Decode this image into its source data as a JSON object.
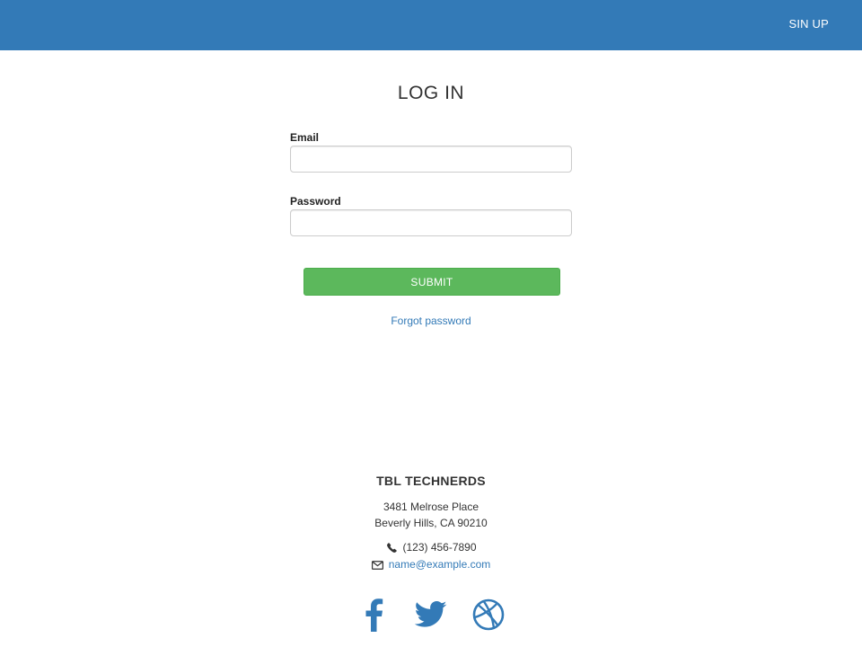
{
  "navbar": {
    "signup_label": "SIN UP",
    "background_color": "#337ab7"
  },
  "login": {
    "title": "LOG IN",
    "email_label": "Email",
    "email_value": "",
    "email_placeholder": "",
    "password_label": "Password",
    "password_value": "",
    "password_placeholder": "",
    "submit_label": "SUBMIT",
    "submit_color": "#5cb85c",
    "forgot_label": "Forgot password"
  },
  "footer": {
    "company": "TBL TECHNERDS",
    "address_line1": "3481 Melrose Place",
    "address_line2": "Beverly Hills, CA 90210",
    "phone": "(123) 456-7890",
    "email": "name@example.com",
    "phone_icon": "phone-icon",
    "email_icon": "envelope-icon",
    "social": [
      "facebook-icon",
      "twitter-icon",
      "dribbble-icon"
    ],
    "link_color": "#337ab7"
  }
}
